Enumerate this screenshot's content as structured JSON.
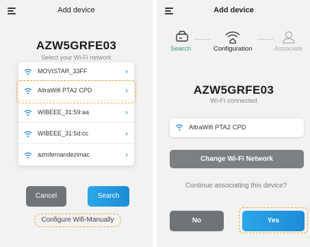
{
  "left": {
    "header": {
      "title": "Add device"
    },
    "device_name": "AZW5GRFE03",
    "subtitle": "Select your Wi-Fi network",
    "networks": [
      {
        "ssid": "MOVISTAR_33FF"
      },
      {
        "ssid": "AltraWifi PTA2 CPD"
      },
      {
        "ssid": "WIBEEE_31:59:aa"
      },
      {
        "ssid": "WIBEEE_31:5d:cc"
      },
      {
        "ssid": "azmfernandezimac"
      }
    ],
    "cancel_label": "Cancel",
    "search_label": "Search",
    "manual_label": "Configure Wifi-Manually"
  },
  "right": {
    "header": {
      "title": "Add device"
    },
    "steps": [
      {
        "label": "Search",
        "state": "done"
      },
      {
        "label": "Configuration",
        "state": "active"
      },
      {
        "label": "Associate",
        "state": "pending"
      }
    ],
    "device_name": "AZW5GRFE03",
    "subtitle": "Wi-Fi connected",
    "connected_ssid": "AltraWifi PTA2 CPD",
    "change_label": "Change Wi-Fi Network",
    "question": "Continue associating this device?",
    "no_label": "No",
    "yes_label": "Yes"
  },
  "colors": {
    "accent": "#1e8cd6",
    "step_done": "#2ea36b",
    "highlight": "#f0a830",
    "secondary_button": "#6f7479"
  }
}
